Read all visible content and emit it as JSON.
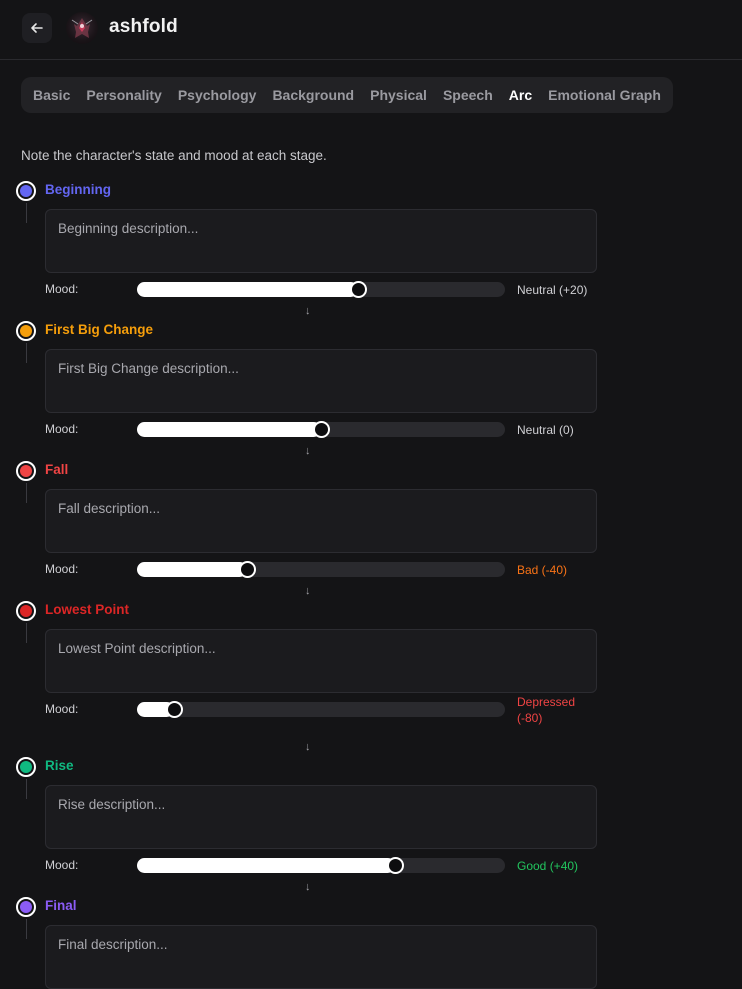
{
  "header": {
    "title": "ashfold",
    "back_icon": "arrow-left-icon",
    "avatar_icon": "character-avatar"
  },
  "tabs": [
    {
      "label": "Basic"
    },
    {
      "label": "Personality"
    },
    {
      "label": "Psychology"
    },
    {
      "label": "Background"
    },
    {
      "label": "Physical"
    },
    {
      "label": "Speech"
    },
    {
      "label": "Arc",
      "active": true
    },
    {
      "label": "Emotional Graph"
    }
  ],
  "hint": "Note the character's state and mood at each stage.",
  "mood_label": "Mood:",
  "arrow": "↓",
  "stages": [
    {
      "title": "Beginning",
      "color": "#6366f1",
      "placeholder": "Beginning description...",
      "mood": 20,
      "mood_text": "Neutral (+20)",
      "mood_color": "#d0d0d4"
    },
    {
      "title": "First Big Change",
      "color": "#f59e0b",
      "placeholder": "First Big Change description...",
      "mood": 0,
      "mood_text": "Neutral (0)",
      "mood_color": "#d0d0d4"
    },
    {
      "title": "Fall",
      "color": "#ef4444",
      "placeholder": "Fall description...",
      "mood": -40,
      "mood_text": "Bad (-40)",
      "mood_color": "#f97316"
    },
    {
      "title": "Lowest Point",
      "color": "#dc2626",
      "placeholder": "Lowest Point description...",
      "mood": -80,
      "mood_text": "Depressed (-80)",
      "mood_color": "#ef4444"
    },
    {
      "title": "Rise",
      "color": "#10b981",
      "placeholder": "Rise description...",
      "mood": 40,
      "mood_text": "Good (+40)",
      "mood_color": "#22c55e"
    },
    {
      "title": "Final",
      "color": "#8b5cf6",
      "placeholder": "Final description...",
      "mood": null,
      "mood_text": "",
      "mood_color": "#d0d0d4"
    }
  ]
}
